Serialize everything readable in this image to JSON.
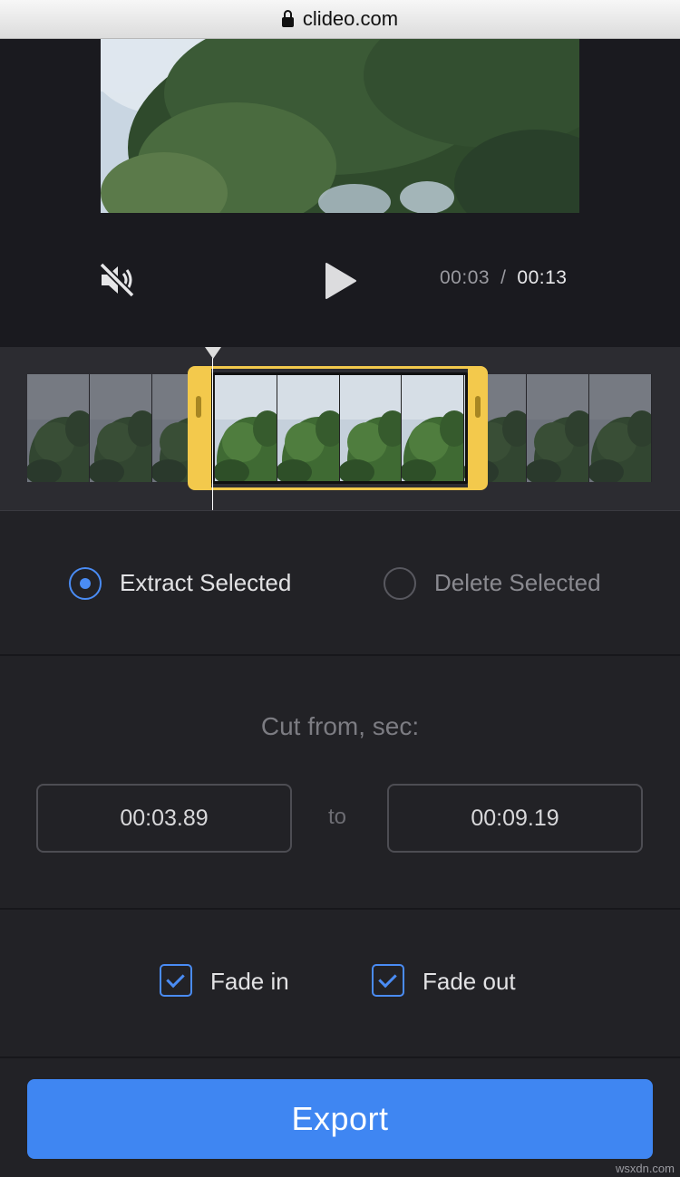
{
  "browser": {
    "url": "clideo.com"
  },
  "player": {
    "current_time": "00:03",
    "separator": "/",
    "total_time": "00:13",
    "mute_icon": "speaker-muted-icon",
    "play_icon": "play-icon"
  },
  "timeline": {
    "thumbnail_count": 10,
    "selection_handle_color": "#f3c94c"
  },
  "mode": {
    "options": [
      {
        "label": "Extract Selected",
        "selected": true
      },
      {
        "label": "Delete Selected",
        "selected": false
      }
    ]
  },
  "cut": {
    "title": "Cut from, sec:",
    "from_value": "00:03.89",
    "to_label": "to",
    "to_value": "00:09.19"
  },
  "fades": {
    "fade_in": {
      "label": "Fade in",
      "checked": true
    },
    "fade_out": {
      "label": "Fade out",
      "checked": true
    }
  },
  "export": {
    "label": "Export"
  },
  "colors": {
    "accent": "#3f86f2",
    "selection": "#f3c94c",
    "background": "#222226"
  },
  "watermark": "wsxdn.com"
}
